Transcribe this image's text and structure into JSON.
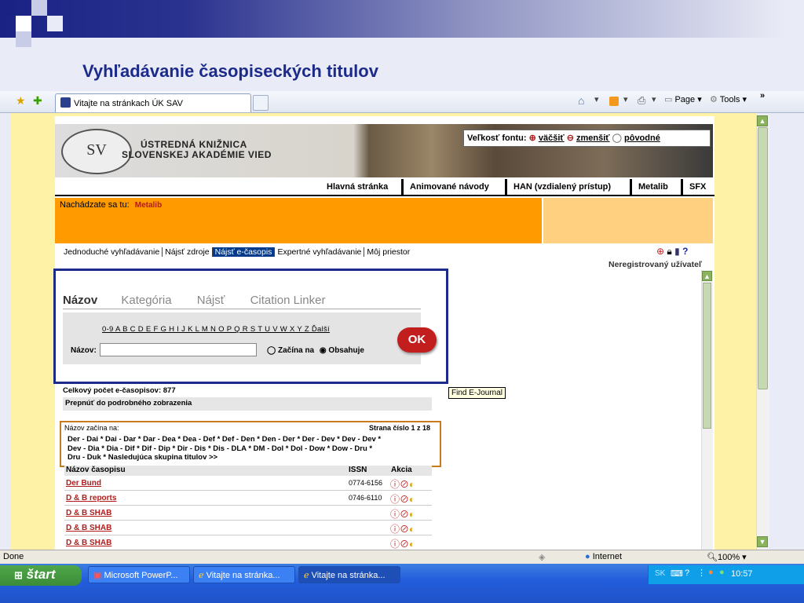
{
  "slide": {
    "title": "Vyhľadávanie časopiseckých titulov"
  },
  "browser": {
    "tab_title": "Vitajte na stránkach ÚK SAV",
    "toolbar": {
      "page": "Page",
      "tools": "Tools",
      "more": "»"
    },
    "status_left": "Done",
    "zone": "Internet",
    "zoom": "100%"
  },
  "site": {
    "library_name_line1": "ÚSTREDNÁ KNIŽNICA",
    "library_name_line2": "SLOVENSKEJ AKADÉMIE VIED",
    "logo_text": "SV",
    "font_size_label": "Veľkosť fontu:",
    "font_bigger": "väčšiť",
    "font_smaller": "zmenšiť",
    "font_original": "pôvodné",
    "nav": [
      "Hlavná stránka",
      "Animované návody",
      "HAN (vzdialený prístup)",
      "Metalib",
      "SFX"
    ],
    "location_label": "Nachádzate sa tu:",
    "location_value": "Metalib"
  },
  "metalib": {
    "tabs": [
      "Jednoduché vyhľadávanie",
      "Nájsť zdroje",
      "Nájsť e-časopis",
      "Expertné vyhľadávanie",
      "Môj priestor"
    ],
    "unregistered": "Neregistrovaný užívateľ",
    "search_tabs": [
      "Názov",
      "Kategória",
      "Nájsť",
      "Citation Linker"
    ],
    "alphabet": "0-9 A B C D E F G H I J K L M N O P Q R S T U V W X Y Z Ďalší",
    "title_label": "Názov:",
    "title_value": "",
    "radio_starts": "Začína na",
    "radio_contains": "Obsahuje",
    "ok_label": "OK",
    "tooltip": "Find E-Journal",
    "total_count": "Celkový počet e-časopisov: 877",
    "switch_detailed": "Prepnúť do podrobného zobrazenia",
    "starts_with_label": "Názov začína na:",
    "page_info": "Strana číslo 1 z 18",
    "letter_ranges_line1": "Der - Dai * Dai - Dar * Dar - Dea * Dea - Def * Def - Den * Den - Der * Der - Dev * Dev - Dev *",
    "letter_ranges_line2": "Dev - Dia * Dia - Dif * Dif - Dip * Dir - Dis * Dis - DLA * DM - Dol * Dol - Dow * Dow - Dru *",
    "letter_ranges_line3": "Dru - Duk * Nasledujúca skupina titulov >>",
    "table_headers": {
      "name": "Názov časopisu",
      "issn": "ISSN",
      "action": "Akcia"
    },
    "rows": [
      {
        "title": "Der Bund",
        "issn": "0774-6156"
      },
      {
        "title": "D & B reports",
        "issn": "0746-6110"
      },
      {
        "title": "D & B SHAB",
        "issn": ""
      },
      {
        "title": "D & B SHAB",
        "issn": ""
      },
      {
        "title": "D & B SHAB",
        "issn": ""
      }
    ]
  },
  "taskbar": {
    "start": "štart",
    "items": [
      "Microsoft PowerP...",
      "Vitajte na stránka...",
      "Vitajte na stránka..."
    ],
    "lang": "SK",
    "clock": "10:57"
  }
}
